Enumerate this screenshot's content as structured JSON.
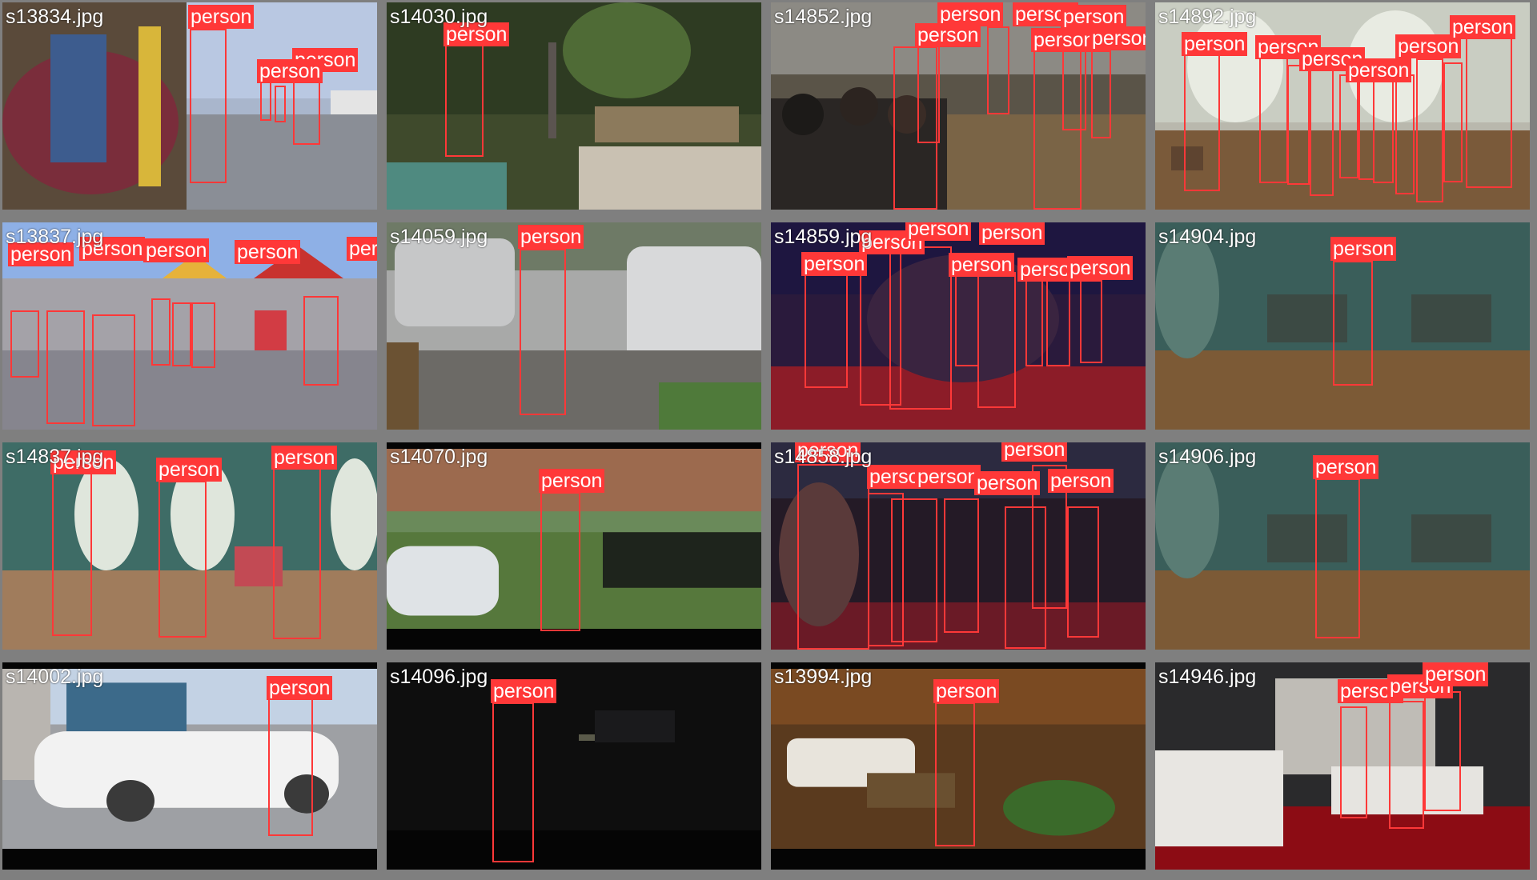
{
  "colors": {
    "box": "#ff3838",
    "label_text": "#ffffff",
    "border": "#7f7f7f"
  },
  "tiles": [
    {
      "filename": "s13834.jpg",
      "label": "person",
      "count": 6
    },
    {
      "filename": "s14030.jpg",
      "label": "person",
      "count": 1
    },
    {
      "filename": "s14852.jpg",
      "label": "person",
      "count": 8
    },
    {
      "filename": "s14892.jpg",
      "label": "person",
      "count": 14
    },
    {
      "filename": "s13837.jpg",
      "label": "person",
      "count": 14
    },
    {
      "filename": "s14059.jpg",
      "label": "person",
      "count": 1
    },
    {
      "filename": "s14859.jpg",
      "label": "person",
      "count": 9
    },
    {
      "filename": "s14904.jpg",
      "label": "person",
      "count": 1
    },
    {
      "filename": "s14837.jpg",
      "label": "person",
      "count": 3
    },
    {
      "filename": "s14070.jpg",
      "label": "person",
      "count": 1
    },
    {
      "filename": "s14858.jpg",
      "label": "person",
      "count": 10
    },
    {
      "filename": "s14906.jpg",
      "label": "person",
      "count": 1
    },
    {
      "filename": "s14002.jpg",
      "label": "person",
      "count": 1
    },
    {
      "filename": "s14096.jpg",
      "label": "person",
      "count": 1
    },
    {
      "filename": "s13994.jpg",
      "label": "person",
      "count": 1
    },
    {
      "filename": "s14946.jpg",
      "label": "person",
      "count": 4
    }
  ]
}
